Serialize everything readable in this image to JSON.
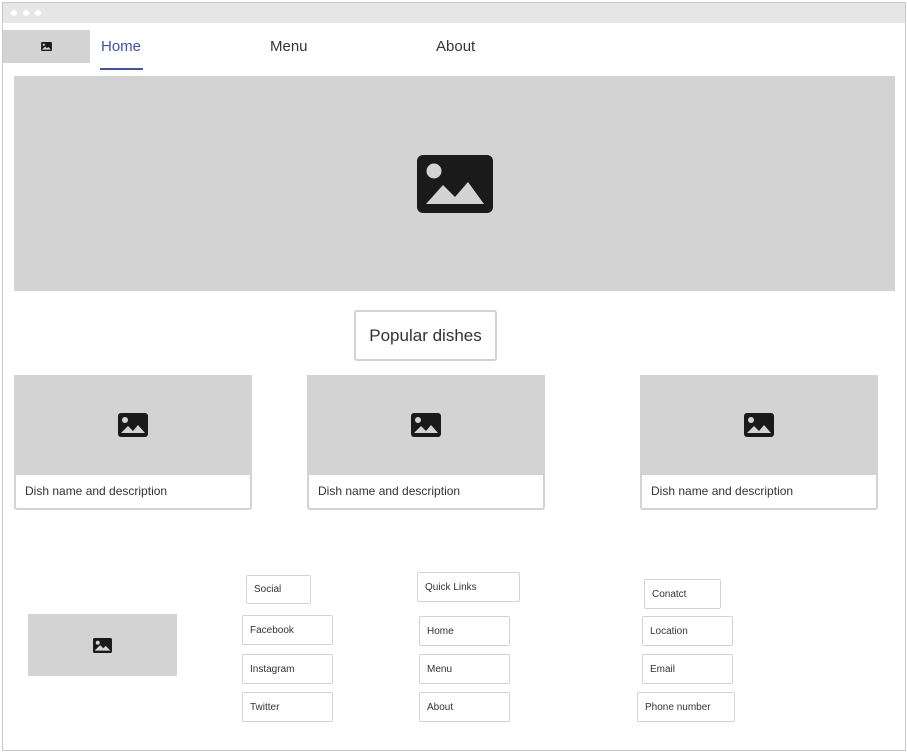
{
  "nav": {
    "items": [
      {
        "label": "Home",
        "active": true
      },
      {
        "label": "Menu",
        "active": false
      },
      {
        "label": "About",
        "active": false
      }
    ]
  },
  "popular": {
    "title": "Popular dishes",
    "dishes": [
      {
        "caption": "Dish name and description"
      },
      {
        "caption": "Dish name and description"
      },
      {
        "caption": "Dish name and description"
      }
    ]
  },
  "footer": {
    "social": {
      "heading": "Social",
      "links": [
        "Facebook",
        "Instagram",
        "Twitter"
      ]
    },
    "quick_links": {
      "heading": "Quick Links",
      "links": [
        "Home",
        "Menu",
        "About"
      ]
    },
    "contact": {
      "heading": "Conatct",
      "items": [
        "Location",
        "Email",
        "Phone number"
      ]
    }
  },
  "colors": {
    "accent": "#3f51b5",
    "placeholder": "#d3d3d3",
    "icon": "#1a1a1a"
  },
  "icons": {
    "image_placeholder": "image-icon"
  }
}
